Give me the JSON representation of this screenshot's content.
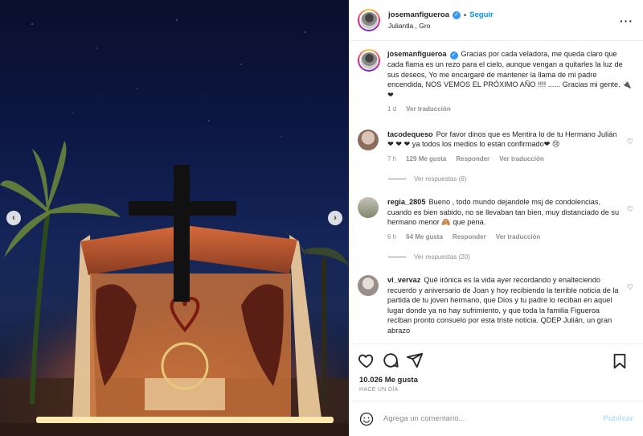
{
  "header": {
    "username": "josemanfigueroa",
    "dot": "•",
    "follow_label": "Seguir",
    "location": "Juliantla , Gro",
    "more_label": "···"
  },
  "caption": {
    "username": "josemanfigueroa",
    "text": "Gracias por cada veladora, me queda claro que cada flama es un rezo para el cielo, aunque vengan a quitarles la luz de sus deseos, Yo me encargaré de mantener la llama de mi padre encendida, NOS VEMOS EL PRÓXIMO AÑO !!!! ...... Gracias mi gente. 🔌❤",
    "time": "1 d",
    "translate": "Ver traducción"
  },
  "comments": [
    {
      "username": "tacodequeso",
      "text": "Por favor dinos que es Mentira lo de tu Hermano Julián ❤ ❤ ❤ ya todos los medios lo están confirmado❤ 😢",
      "time": "7 h",
      "likes": "129 Me gusta",
      "reply": "Responder",
      "translate": "Ver traducción",
      "replies": "Ver respuestas (6)"
    },
    {
      "username": "regia_2805",
      "text": "Bueno , todo mundo dejandole msj de condolencias, cuando es bien sabido, no se llevaban tan bien, muy distanciado de su hermano menor 🙈 que pena.",
      "time": "6 h",
      "likes": "64 Me gusta",
      "reply": "Responder",
      "translate": "Ver traducción",
      "replies": "Ver respuestas (20)"
    },
    {
      "username": "vi_vervaz",
      "text": "Qué irónica es la vida ayer recordando y enalteciendo recuerdo y aniversario de Joan y hoy recibiendo la terrible noticia de la partida de tu joven hermano, que Dios y tu padre lo reciban en aquel lugar donde ya no hay sufrimiento, y que toda la familia Figueroa reciban pronto consuelo por esta triste noticia. QDEP Julián, un gran abrazo"
    }
  ],
  "footer": {
    "likes": "10.026 Me gusta",
    "time": "HACE UN DÍA",
    "comment_placeholder": "Agrega un comentario...",
    "publish_label": "Publicar"
  },
  "media": {
    "prev_label": "‹",
    "next_label": "›"
  },
  "colors": {
    "link": "#0095f6",
    "verified": "#3897f0",
    "heart": "#d0021b"
  }
}
